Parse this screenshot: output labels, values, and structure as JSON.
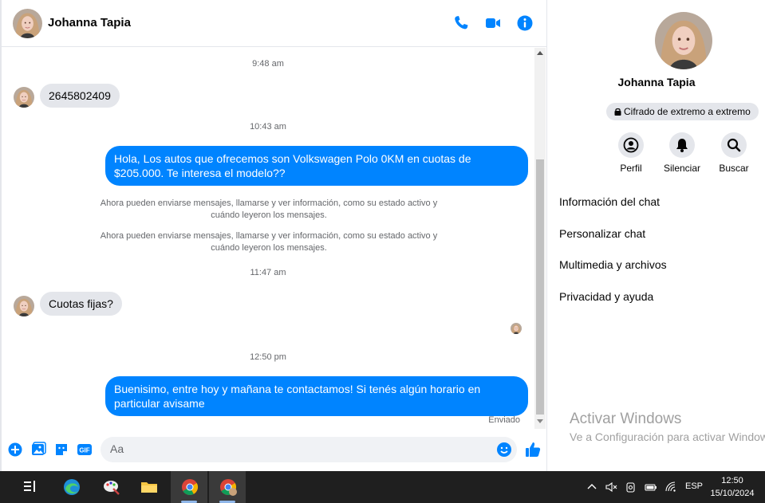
{
  "chat": {
    "contact_name": "Johanna Tapia",
    "colors": {
      "accent": "#0084ff",
      "incoming_bubble": "#e4e6eb"
    },
    "timestamps": [
      "9:48 am",
      "10:43 am",
      "11:47 am",
      "12:50 pm"
    ],
    "msg1": "2645802409",
    "msg2": "Hola, Los autos que ofrecemos son Volkswagen Polo 0KM en cuotas de $205.000. Te interesa el modelo??",
    "sys1": "Ahora pueden enviarse mensajes, llamarse y ver información, como su estado activo y cuándo leyeron los mensajes.",
    "sys2": "Ahora pueden enviarse mensajes, llamarse y ver información, como su estado activo y cuándo leyeron los mensajes.",
    "msg3": "Cuotas fijas?",
    "msg4": "Buenisimo, entre hoy y mañana te contactamos! Si tenés algún horario en particular avisame",
    "sent_status": "Enviado",
    "composer_placeholder": "Aa",
    "header_icons": [
      "phone-icon",
      "video-icon",
      "info-icon"
    ],
    "composer_icons": [
      "plus-icon",
      "gallery-icon",
      "sticker-icon",
      "gif-icon",
      "emoji-icon",
      "like-icon"
    ]
  },
  "info": {
    "name": "Johanna Tapia",
    "encryption": "Cifrado de extremo a extremo",
    "actions": {
      "profile": "Perfil",
      "mute": "Silenciar",
      "search": "Buscar"
    },
    "menu": {
      "chat_info": "Información del chat",
      "customize": "Personalizar chat",
      "media": "Multimedia y archivos",
      "privacy": "Privacidad y ayuda"
    },
    "watermark_title": "Activar Windows",
    "watermark_sub": "Ve a Configuración para activar Windows."
  },
  "taskbar": {
    "gif_label": "GIF",
    "language": "ESP",
    "time": "12:50",
    "date": "15/10/2024"
  }
}
